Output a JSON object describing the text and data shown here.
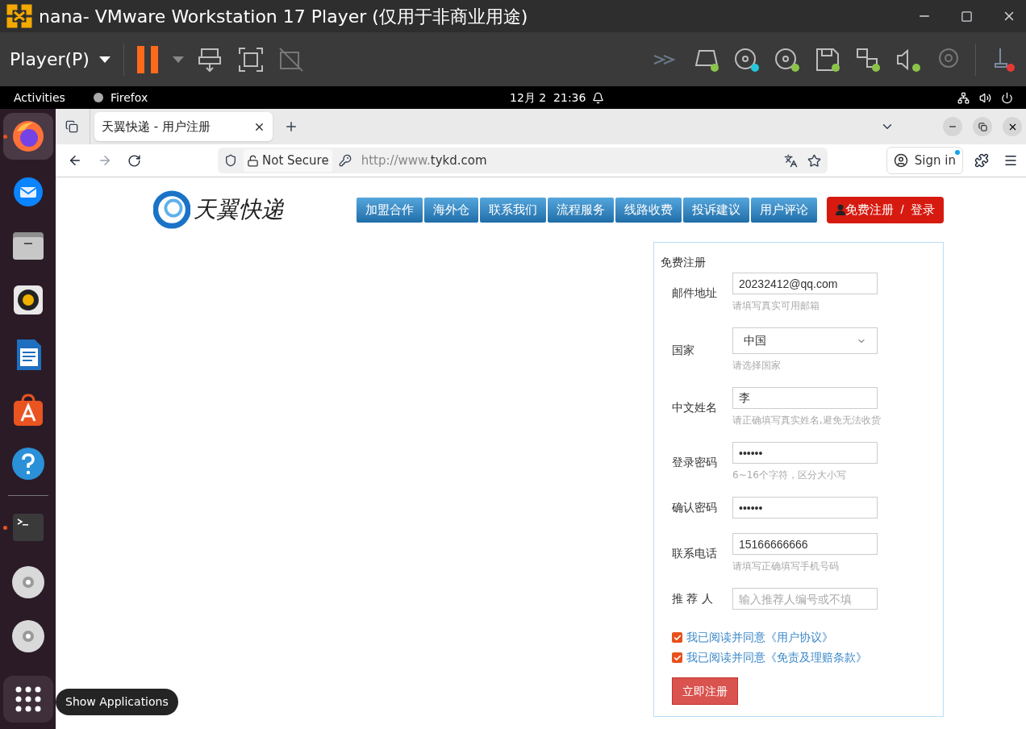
{
  "vm": {
    "title": "nana- VMware Workstation 17 Player (仅用于非商业用途)",
    "menu": "Player(P)"
  },
  "topbar": {
    "activities": "Activities",
    "app": "Firefox",
    "clock": "12月 2  21:36"
  },
  "dock": {
    "items": [
      {
        "kind": "firefox",
        "running": true,
        "selected": true
      },
      {
        "kind": "mail",
        "running": false,
        "selected": false
      },
      {
        "kind": "files",
        "running": false,
        "selected": false
      },
      {
        "kind": "music",
        "running": false,
        "selected": false
      },
      {
        "kind": "writer",
        "running": false,
        "selected": false
      },
      {
        "kind": "store",
        "running": false,
        "selected": false
      },
      {
        "kind": "help",
        "running": false,
        "selected": false
      },
      {
        "kind": "terminal",
        "running": true,
        "selected": false
      },
      {
        "kind": "disc",
        "running": false,
        "selected": false
      },
      {
        "kind": "disc",
        "running": false,
        "selected": false
      }
    ],
    "tooltip": "Show Applications"
  },
  "browser": {
    "tab": "天翼快递 - 用户注册",
    "security": "Not Secure",
    "url_prefix": "http://www.",
    "url_host": "tykd.com",
    "sign_in": "Sign in"
  },
  "site": {
    "logo": "天翼快递",
    "nav": [
      "加盟合作",
      "海外仓",
      "联系我们",
      "流程服务",
      "线路收费",
      "投诉建议",
      "用户评论"
    ],
    "register": "免费注册",
    "slash": "/",
    "login": "登录",
    "form": {
      "title": "免费注册",
      "fields": [
        {
          "label": "邮件地址",
          "kind": "text",
          "value": "20232412@qq.com",
          "hint": "请填写真实可用邮箱"
        },
        {
          "label": "国家",
          "kind": "select",
          "value": "中国",
          "hint": "请选择国家"
        },
        {
          "label": "中文姓名",
          "kind": "text",
          "value": "李",
          "hint": "请正确填写真实姓名,避免无法收货"
        },
        {
          "label": "登录密码",
          "kind": "text",
          "value": "••••••",
          "hint": "6~16个字符，区分大小写"
        },
        {
          "label": "确认密码",
          "kind": "text",
          "value": "••••••"
        },
        {
          "label": "联系电话",
          "kind": "text",
          "value": "15166666666",
          "hint": "请填写正确填写手机号码"
        },
        {
          "label": "推 荐 人",
          "kind": "text",
          "placeholder": "输入推荐人编号或不填"
        }
      ],
      "agreements": [
        {
          "text": "我已阅读并同意《用户协议》",
          "checked": true
        },
        {
          "text": "我已阅读并同意《免责及理赔条款》",
          "checked": true
        }
      ],
      "submit": "立即注册"
    }
  }
}
